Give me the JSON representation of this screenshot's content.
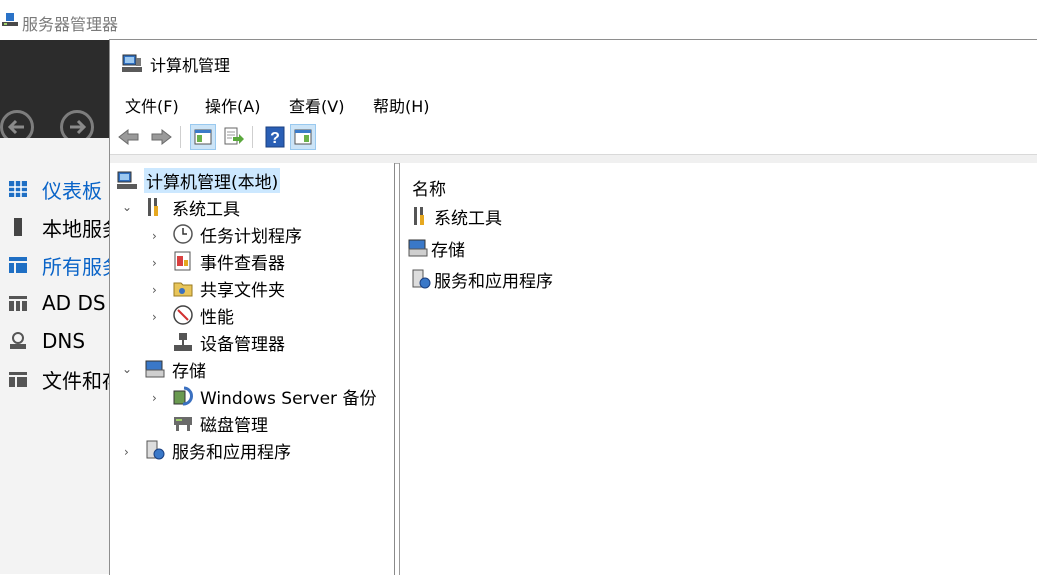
{
  "server_manager": {
    "title": "服务器管理器",
    "sidebar": [
      {
        "label": "仪表板",
        "icon": "dashboard-icon",
        "active": true
      },
      {
        "label": "本地服务器",
        "icon": "local-server-icon",
        "active": false
      },
      {
        "label": "所有服务器",
        "icon": "all-servers-icon",
        "active": true
      },
      {
        "label": "AD DS",
        "icon": "ad-ds-icon",
        "active": false
      },
      {
        "label": "DNS",
        "icon": "dns-icon",
        "active": false
      },
      {
        "label": "文件和存储服务",
        "icon": "file-storage-icon",
        "active": false
      }
    ]
  },
  "window": {
    "title": "计算机管理",
    "menu": [
      "文件(F)",
      "操作(A)",
      "查看(V)",
      "帮助(H)"
    ],
    "toolbar": [
      {
        "icon": "back-arrow-icon"
      },
      {
        "icon": "forward-arrow-icon"
      },
      {
        "icon": "show-hide-console-tree-icon"
      },
      {
        "icon": "export-list-icon"
      },
      {
        "icon": "help-icon"
      },
      {
        "icon": "show-hide-action-pane-icon"
      }
    ]
  },
  "tree": {
    "root": "计算机管理(本地)",
    "items": [
      {
        "label": "系统工具",
        "icon": "system-tools-icon",
        "expanded": true
      },
      {
        "label": "任务计划程序",
        "icon": "task-scheduler-icon"
      },
      {
        "label": "事件查看器",
        "icon": "event-viewer-icon"
      },
      {
        "label": "共享文件夹",
        "icon": "shared-folders-icon"
      },
      {
        "label": "性能",
        "icon": "performance-icon"
      },
      {
        "label": "设备管理器",
        "icon": "device-manager-icon"
      },
      {
        "label": "存储",
        "icon": "storage-icon",
        "expanded": true
      },
      {
        "label": "Windows Server 备份",
        "icon": "windows-server-backup-icon"
      },
      {
        "label": "磁盘管理",
        "icon": "disk-management-icon"
      },
      {
        "label": "服务和应用程序",
        "icon": "services-apps-icon"
      }
    ]
  },
  "details": {
    "column_header": "名称",
    "items": [
      {
        "label": "系统工具",
        "icon": "system-tools-icon"
      },
      {
        "label": "存储",
        "icon": "storage-icon"
      },
      {
        "label": "服务和应用程序",
        "icon": "services-apps-icon"
      }
    ]
  }
}
